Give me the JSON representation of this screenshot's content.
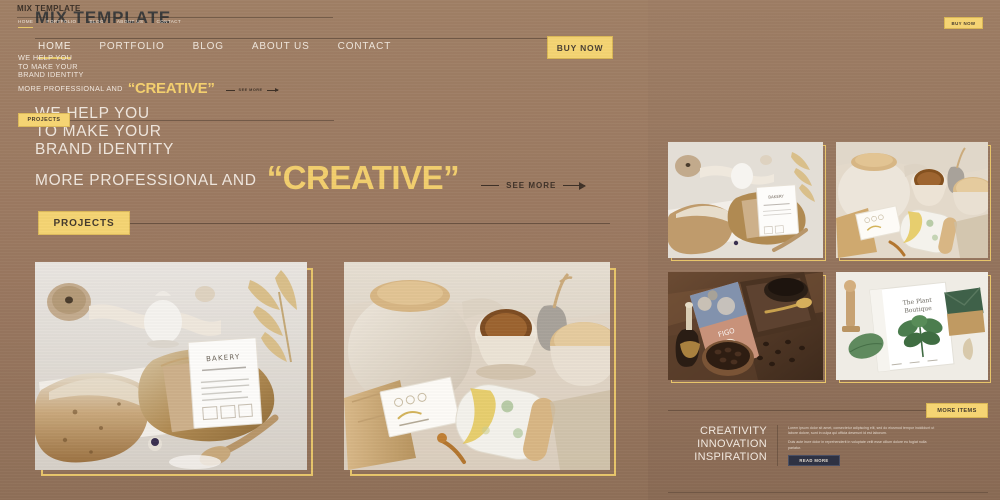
{
  "brand": "MIX TEMPLATE",
  "nav": [
    {
      "label": "HOME",
      "active": true
    },
    {
      "label": "PORTFOLIO",
      "active": false
    },
    {
      "label": "BLOG",
      "active": false
    },
    {
      "label": "ABOUT US",
      "active": false
    },
    {
      "label": "CONTACT",
      "active": false
    }
  ],
  "buttons": {
    "buy_now": "BUY NOW",
    "more_items": "MORE ITEMS",
    "read_more": "READ MORE",
    "see_more": "SEE MORE"
  },
  "hero": {
    "line1": "WE HELP YOU",
    "line2": "TO MAKE YOUR",
    "line3": "BRAND IDENTITY",
    "line4": "MORE PROFESSIONAL AND",
    "highlight": "“CREATIVE”"
  },
  "projects": {
    "tag": "PROJECTS"
  },
  "bottom": {
    "head1": "CREATIVITY",
    "head2": "INNOVATION",
    "head3": "INSPIRATION",
    "para1": "Lorem ipsum dolor sit amet, consectetur adipiscing elit, sed do eiusmod tempor incididunt ut labore dolore, sunt in culpa qui officia deserunt id est laborum.",
    "para2": "Duis aute irure dolor in reprehenderit in voluptate velit esse cillum dolore eu fugiat nulla pariatur."
  },
  "colors": {
    "background": "#9c7a62",
    "accent_yellow": "#f5d473",
    "highlight_text": "#f3cf6e",
    "dark_button": "#2e3243",
    "body_text": "#f0e7de"
  },
  "photos": {
    "p1": "bakery-bread-wooden-board-card",
    "p2": "tea-set-teapot-cup-canister",
    "p3": "coffee-candle-beans-tray",
    "p4": "plant-boutique-magazine-envelope"
  }
}
